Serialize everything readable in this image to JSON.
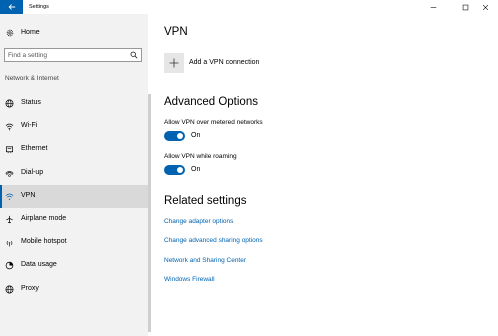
{
  "window": {
    "title": "Settings",
    "back_icon": "arrow-left-icon",
    "accent_color": "#0063b1"
  },
  "sidebar": {
    "home_label": "Home",
    "search_placeholder": "Find a setting",
    "category": "Network & Internet",
    "items": [
      {
        "label": "Status",
        "icon": "globe-icon",
        "selected": false
      },
      {
        "label": "Wi-Fi",
        "icon": "wifi-icon",
        "selected": false
      },
      {
        "label": "Ethernet",
        "icon": "ethernet-icon",
        "selected": false
      },
      {
        "label": "Dial-up",
        "icon": "dialup-icon",
        "selected": false
      },
      {
        "label": "VPN",
        "icon": "vpn-icon",
        "selected": true
      },
      {
        "label": "Airplane mode",
        "icon": "airplane-icon",
        "selected": false
      },
      {
        "label": "Mobile hotspot",
        "icon": "hotspot-icon",
        "selected": false
      },
      {
        "label": "Data usage",
        "icon": "data-usage-icon",
        "selected": false
      },
      {
        "label": "Proxy",
        "icon": "globe-icon",
        "selected": false
      }
    ]
  },
  "main": {
    "title": "VPN",
    "add_vpn_label": "Add a VPN connection",
    "advanced": {
      "title": "Advanced Options",
      "metered_label": "Allow VPN over metered networks",
      "metered_state": "On",
      "roaming_label": "Allow VPN while roaming",
      "roaming_state": "On"
    },
    "related": {
      "title": "Related settings",
      "links": [
        "Change adapter options",
        "Change advanced sharing options",
        "Network and Sharing Center",
        "Windows Firewall"
      ]
    }
  }
}
